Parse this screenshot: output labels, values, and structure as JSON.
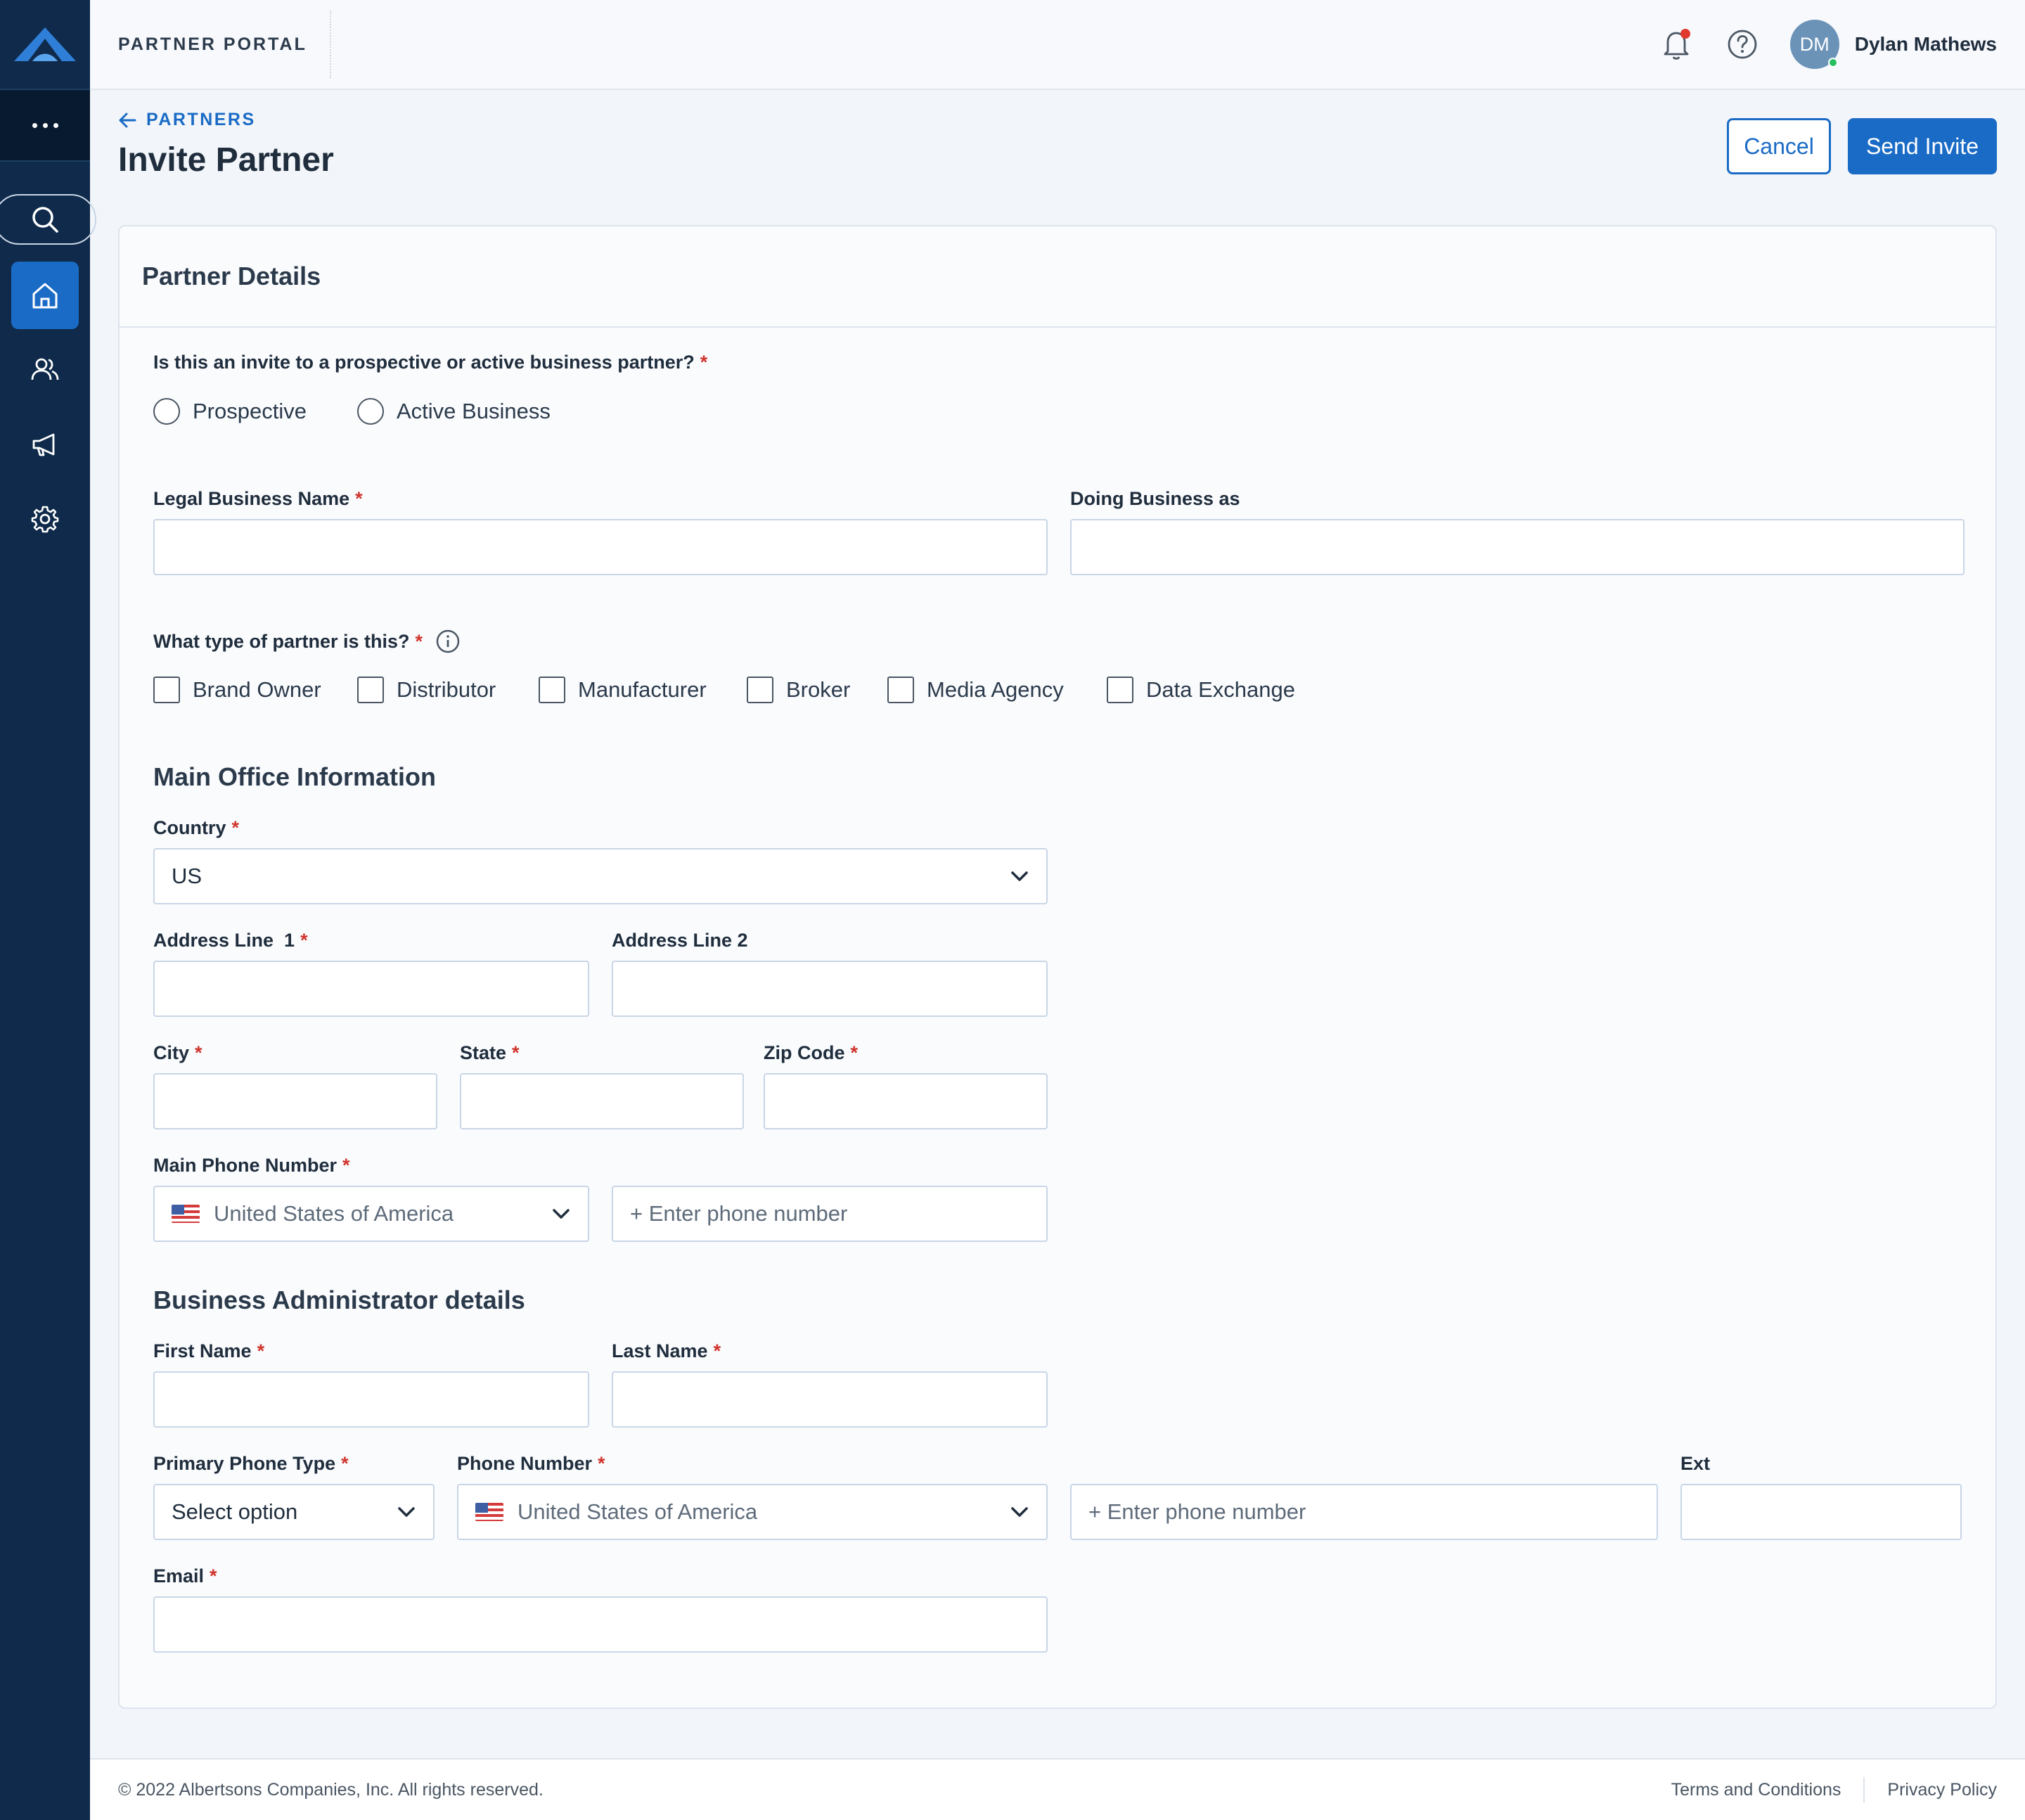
{
  "header": {
    "portal_title": "PARTNER PORTAL",
    "avatar_initials": "DM",
    "user_name": "Dylan Mathews"
  },
  "sidebar": {
    "items": [
      {
        "icon": "search-icon"
      },
      {
        "icon": "home-icon",
        "active": true
      },
      {
        "icon": "users-icon"
      },
      {
        "icon": "megaphone-icon"
      },
      {
        "icon": "gear-icon"
      }
    ]
  },
  "page": {
    "breadcrumb": "PARTNERS",
    "title": "Invite Partner",
    "cancel_label": "Cancel",
    "send_label": "Send Invite"
  },
  "card": {
    "title": "Partner Details"
  },
  "form": {
    "invite_question": "Is this an invite to a prospective or active business partner?",
    "invite_options": [
      "Prospective",
      "Active Business"
    ],
    "legal_name_label": "Legal Business Name",
    "dba_label": "Doing Business as",
    "partner_type_question": "What type of partner is this?",
    "partner_types": [
      "Brand Owner",
      "Distributor",
      "Manufacturer",
      "Broker",
      "Media Agency",
      "Data Exchange"
    ],
    "main_office_title": "Main Office Information",
    "country_label": "Country",
    "country_value": "US",
    "address1_label": "Address Line  1",
    "address2_label": "Address Line 2",
    "city_label": "City",
    "state_label": "State",
    "zip_label": "Zip Code",
    "main_phone_label": "Main Phone Number",
    "main_phone_country": "United States of America",
    "main_phone_placeholder": "+ Enter phone number",
    "admin_title": "Business Administrator details",
    "first_name_label": "First Name",
    "last_name_label": "Last Name",
    "phone_type_label": "Primary Phone Type",
    "phone_type_value": "Select option",
    "phone_number_label": "Phone Number",
    "phone_country": "United States of America",
    "phone_placeholder": "+ Enter phone number",
    "ext_label": "Ext",
    "email_label": "Email",
    "required_mark": "*"
  },
  "footer": {
    "copyright": "© 2022 Albertsons Companies, Inc. All rights reserved.",
    "terms": "Terms and Conditions",
    "privacy": "Privacy Policy"
  },
  "colors": {
    "primary": "#1a6bc6",
    "sidebar": "#0f2a4a",
    "required": "#d0342c"
  }
}
